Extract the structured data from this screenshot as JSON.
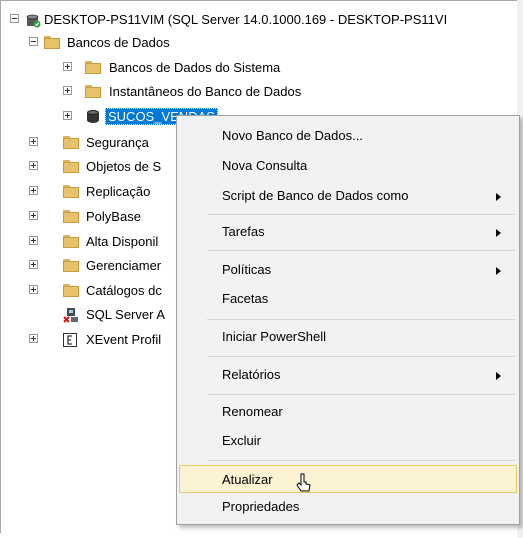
{
  "tree": {
    "server_label": "DESKTOP-PS11VIM (SQL Server 14.0.1000.169 - DESKTOP-PS11VI",
    "databases_label": "Bancos de Dados",
    "system_dbs_label": "Bancos de Dados do Sistema",
    "snapshots_label": "Instantâneos do Banco de Dados",
    "selected_db_label": "SUCOS_VENDAS",
    "nodes": [
      "Segurança",
      "Objetos de S",
      "Replicação",
      "PolyBase",
      "Alta Disponil",
      "Gerenciamer",
      "Catálogos dc",
      "SQL Server A",
      "XEvent Profil"
    ]
  },
  "context_menu": {
    "items": [
      "Novo Banco de Dados...",
      "Nova Consulta",
      "Script de Banco de Dados como",
      "Tarefas",
      "Políticas",
      "Facetas",
      "Iniciar PowerShell",
      "Relatórios",
      "Renomear",
      "Excluir",
      "Atualizar",
      "Propriedades"
    ],
    "highlighted_item": "Atualizar"
  },
  "colors": {
    "selection": "#0078d7",
    "folder": "#e8c26a",
    "menu_bg": "#f2f2f2",
    "hover_bg": "#fcf3d3"
  }
}
